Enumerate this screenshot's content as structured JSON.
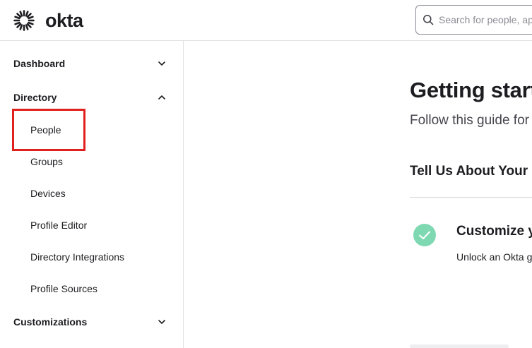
{
  "header": {
    "logo_text": "okta",
    "search_placeholder": "Search for people, apps and groups"
  },
  "sidebar": {
    "dashboard": {
      "label": "Dashboard",
      "icon": "chevron-down-icon"
    },
    "directory": {
      "label": "Directory",
      "icon": "chevron-up-icon",
      "items": [
        {
          "label": "People"
        },
        {
          "label": "Groups"
        },
        {
          "label": "Devices"
        },
        {
          "label": "Profile Editor"
        },
        {
          "label": "Directory Integrations"
        },
        {
          "label": "Profile Sources"
        }
      ]
    },
    "customizations": {
      "label": "Customizations",
      "icon": "chevron-down-icon"
    }
  },
  "main": {
    "title": "Getting started with Okta",
    "subtitle": "Follow this guide for",
    "section_heading": "Tell Us About Your",
    "task": {
      "title": "Customize your",
      "description": "Unlock an Okta guide",
      "status": "completed"
    }
  },
  "colors": {
    "accent_highlight": "#e0201d",
    "check_green": "#7ed9b2",
    "text_primary": "#1d1d21",
    "border": "#e1e1e4"
  }
}
